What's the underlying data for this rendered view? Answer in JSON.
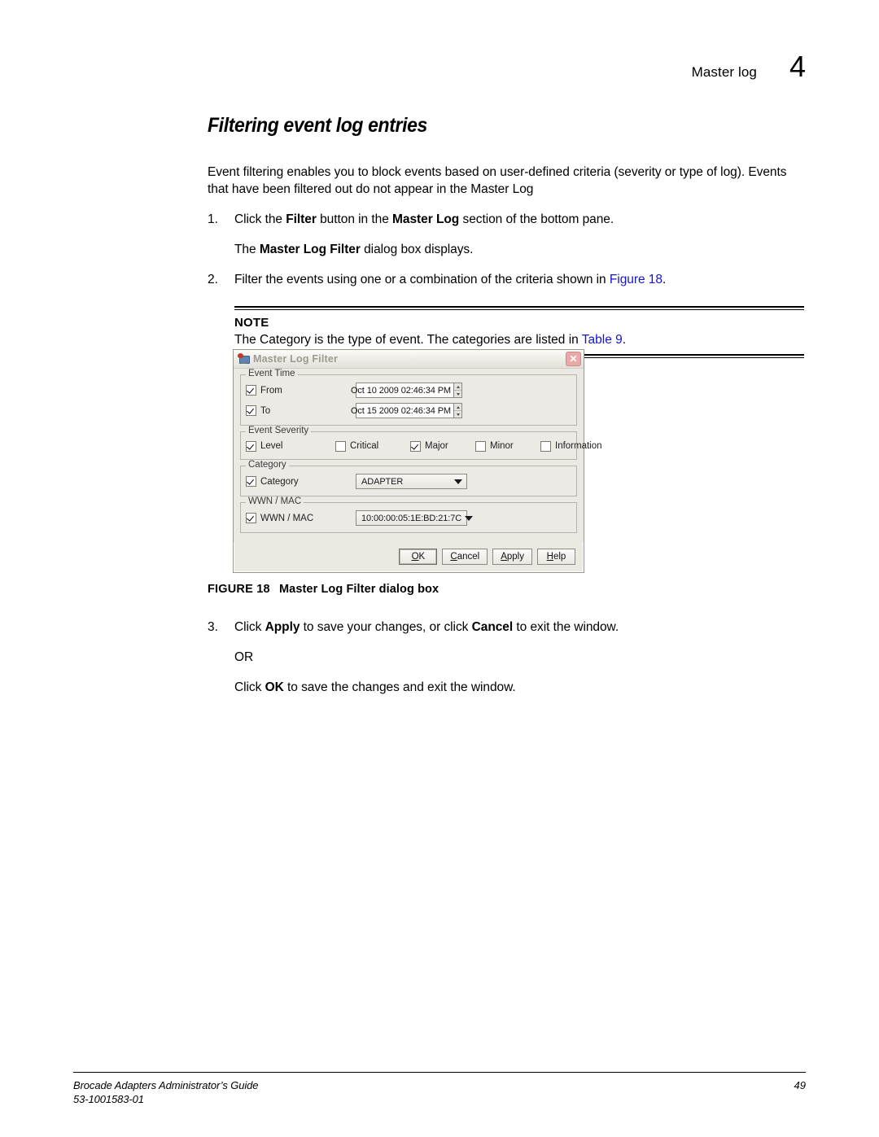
{
  "header": {
    "running_head": "Master log",
    "chapter_number": "4"
  },
  "section": {
    "title": "Filtering event log entries",
    "intro_line1": "Event filtering enables you to block events based on user-defined criteria (severity or type of log).",
    "intro_line2": "Events that have been filtered out do not appear in the Master Log"
  },
  "steps": {
    "step1": {
      "number": "1.",
      "prefix": "Click the ",
      "bold1": "Filter",
      "mid": " button in the ",
      "bold2": "Master Log",
      "suffix": " section of the bottom pane."
    },
    "step1_result": {
      "prefix": "The ",
      "bold": "Master Log Filter",
      "suffix": " dialog box displays."
    },
    "step2": {
      "number": "2.",
      "prefix": "Filter the events using one or a combination of the criteria shown in ",
      "xref": "Figure 18",
      "suffix": "."
    },
    "step3": {
      "number": "3.",
      "prefix": "Click ",
      "bold1": "Apply",
      "mid": " to save your changes, or click ",
      "bold2": "Cancel",
      "suffix": " to exit the window."
    },
    "step3_or": "OR",
    "step3_alt": {
      "prefix": "Click ",
      "bold": "OK",
      "suffix": " to save the changes and exit the window."
    }
  },
  "note": {
    "label": "NOTE",
    "text_prefix": "The Category is the type of event. The categories are listed in ",
    "xref": "Table 9",
    "text_suffix": "."
  },
  "dialog": {
    "title": "Master Log Filter",
    "close_label": "✕",
    "groups": {
      "event_time": {
        "title": "Event Time",
        "rows": [
          {
            "label": "From",
            "checked": true,
            "value": "Oct 10 2009  02:46:34  PM"
          },
          {
            "label": "To",
            "checked": true,
            "value": "Oct 15 2009  02:46:34  PM"
          }
        ]
      },
      "event_severity": {
        "title": "Event Severity",
        "items": [
          {
            "label": "Level",
            "checked": true
          },
          {
            "label": "Critical",
            "checked": false
          },
          {
            "label": "Major",
            "checked": true
          },
          {
            "label": "Minor",
            "checked": false
          },
          {
            "label": "Information",
            "checked": false
          }
        ]
      },
      "category": {
        "title": "Category",
        "row": {
          "label": "Category",
          "checked": true,
          "value": "ADAPTER"
        }
      },
      "wwn_mac": {
        "title": "WWN / MAC",
        "row": {
          "label": "WWN / MAC",
          "checked": true,
          "value": "10:00:00:05:1E:BD:21:7C"
        }
      }
    },
    "buttons": [
      {
        "label": "OK",
        "mnemonic": "O",
        "rest": "K",
        "default": true
      },
      {
        "label": "Cancel",
        "mnemonic": "C",
        "rest": "ancel",
        "default": false
      },
      {
        "label": "Apply",
        "mnemonic": "A",
        "rest": "pply",
        "default": false
      },
      {
        "label": "Help",
        "mnemonic": "H",
        "rest": "elp",
        "default": false
      }
    ]
  },
  "figure": {
    "number": "FIGURE 18",
    "title": "Master Log Filter dialog box"
  },
  "footer": {
    "guide_title": "Brocade Adapters Administrator’s Guide",
    "doc_number": "53-1001583-01",
    "page_number": "49"
  },
  "colors": {
    "xref_link": "#1414d2",
    "dialog_face": "#ece9e3",
    "close_button": "#e8a9a9",
    "title_text": "#9d9a93"
  }
}
